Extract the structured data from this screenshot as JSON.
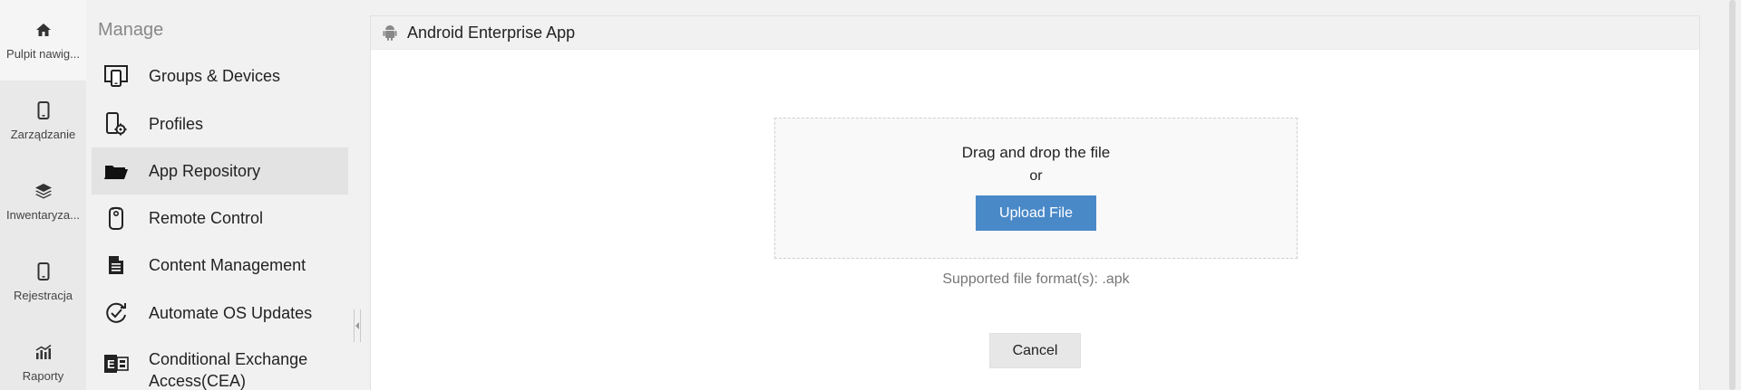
{
  "rail": {
    "items": [
      {
        "label": "Pulpit nawig...",
        "icon": "home-icon"
      },
      {
        "label": "Zarządzanie",
        "icon": "mobile-icon"
      },
      {
        "label": "Inwentaryza...",
        "icon": "layers-icon"
      },
      {
        "label": "Rejestracja",
        "icon": "mobile-icon"
      },
      {
        "label": "Raporty",
        "icon": "bar-chart-icon"
      }
    ]
  },
  "menu": {
    "heading": "Manage",
    "items": [
      {
        "label": "Groups & Devices",
        "icon": "devices-icon"
      },
      {
        "label": "Profiles",
        "icon": "mobile-gear-icon"
      },
      {
        "label": "App Repository",
        "icon": "folder-icon"
      },
      {
        "label": "Remote Control",
        "icon": "remote-control-icon"
      },
      {
        "label": "Content Management",
        "icon": "document-icon"
      },
      {
        "label": "Automate OS Updates",
        "icon": "refresh-check-icon"
      },
      {
        "label": "Conditional Exchange Access(CEA)",
        "icon": "exchange-icon"
      }
    ]
  },
  "panel": {
    "title": "Android Enterprise App",
    "icon": "android-icon",
    "dropzone_text": "Drag and drop the file",
    "or_text": "or",
    "upload_label": "Upload File",
    "supported_formats": "Supported file format(s): .apk",
    "cancel_label": "Cancel"
  },
  "colors": {
    "primary_button": "#4a89c8",
    "rail_bg": "#e9e9e9",
    "menu_bg": "#f1f1f1",
    "active_item_bg": "#e3e3e3"
  }
}
